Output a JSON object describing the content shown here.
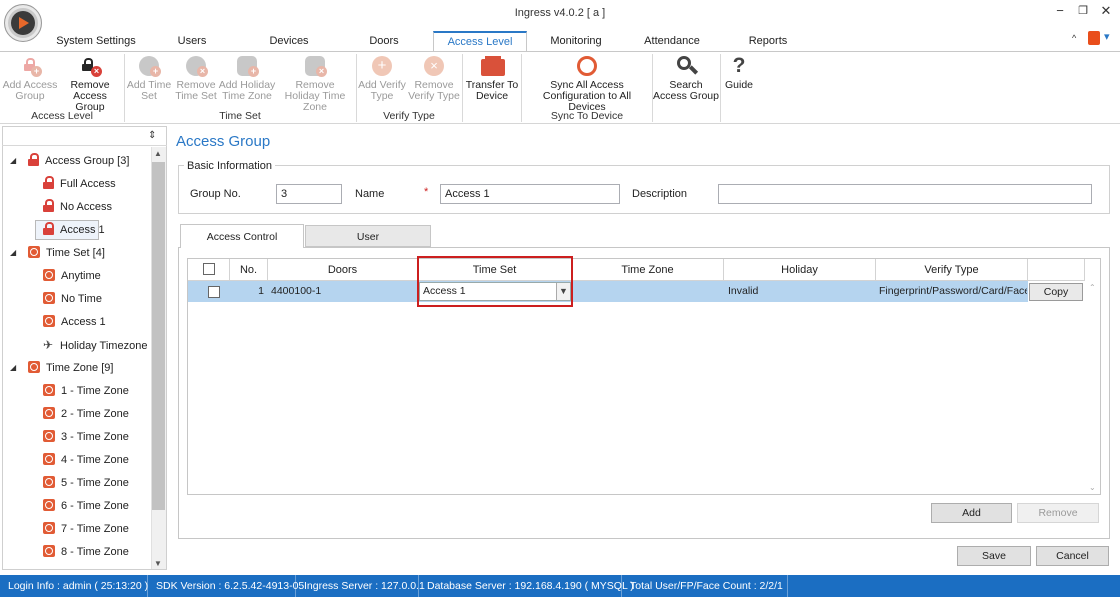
{
  "window": {
    "title": "Ingress v4.0.2 [ a ]",
    "min_icon": "minimize-icon",
    "restore_icon": "restore-icon",
    "close_icon": "close-icon"
  },
  "ribbon_tabs": [
    "System Settings",
    "Users",
    "Devices",
    "Doors",
    "Access Level",
    "Monitoring",
    "Attendance",
    "Reports"
  ],
  "active_tab": "Access Level",
  "ribbon": {
    "add_access_group": "Add Access Group",
    "remove_access_group": "Remove Access Group",
    "group_access_level": "Access Level",
    "add_time_set": "Add Time Set",
    "remove_time_set": "Remove Time Set",
    "add_holiday_tz": "Add Holiday Time Zone",
    "remove_holiday_tz": "Remove Holiday Time Zone",
    "group_time_set": "Time Set",
    "add_verify_type": "Add Verify Type",
    "remove_verify_type": "Remove Verify Type",
    "group_verify_type": "Verify Type",
    "transfer_to_device": "Transfer To Device",
    "sync_all": "Sync All Access Configuration to All Devices",
    "group_sync": "Sync To Device",
    "search_access_group": "Search Access Group",
    "guide": "Guide",
    "help_icon_glyph": "?"
  },
  "tree": {
    "pin_glyph": "⇕",
    "access_group": {
      "label": "Access Group [3]",
      "children": [
        "Full Access",
        "No Access",
        "Access 1"
      ]
    },
    "time_set": {
      "label": "Time Set [4]",
      "children": [
        "Anytime",
        "No Time",
        "Access 1",
        "Holiday Timezone"
      ]
    },
    "time_zone": {
      "label": "Time Zone [9]",
      "children": [
        "1 - Time Zone",
        "2 - Time Zone",
        "3 - Time Zone",
        "4 - Time Zone",
        "5 - Time Zone",
        "6 - Time Zone",
        "7 - Time Zone",
        "8 - Time Zone"
      ]
    }
  },
  "main": {
    "title": "Access Group",
    "basic_info": "Basic Information",
    "group_no_label": "Group No.",
    "group_no_value": "3",
    "name_label": "Name",
    "required_mark": "*",
    "name_value": "Access 1",
    "description_label": "Description",
    "description_value": "",
    "subtabs": [
      "Access Control",
      "User"
    ],
    "columns": [
      "No.",
      "Doors",
      "Time Set",
      "Time Zone",
      "Holiday",
      "Verify Type"
    ],
    "rows": [
      {
        "no": "1",
        "door": "4400100-1",
        "time_set": "Access 1",
        "time_zone": "",
        "holiday": "Invalid",
        "verify_type": "Fingerprint/Password/Card/Face",
        "action": "Copy"
      }
    ],
    "add_label": "Add",
    "remove_label": "Remove",
    "save_label": "Save",
    "cancel_label": "Cancel"
  },
  "status": [
    "Login Info : admin ( 25:13:20 )",
    "SDK Version : 6.2.5.42-4913-05",
    "Ingress Server : 127.0.0.1",
    "Database Server : 192.168.4.190 ( MYSQL )",
    "Total User/FP/Face Count : 2/2/1"
  ],
  "colors": {
    "accent": "#2a78c6",
    "status_bar": "#1b6ec2",
    "highlight_box": "#cc1f1f",
    "selected_row": "#b5d4ef"
  }
}
